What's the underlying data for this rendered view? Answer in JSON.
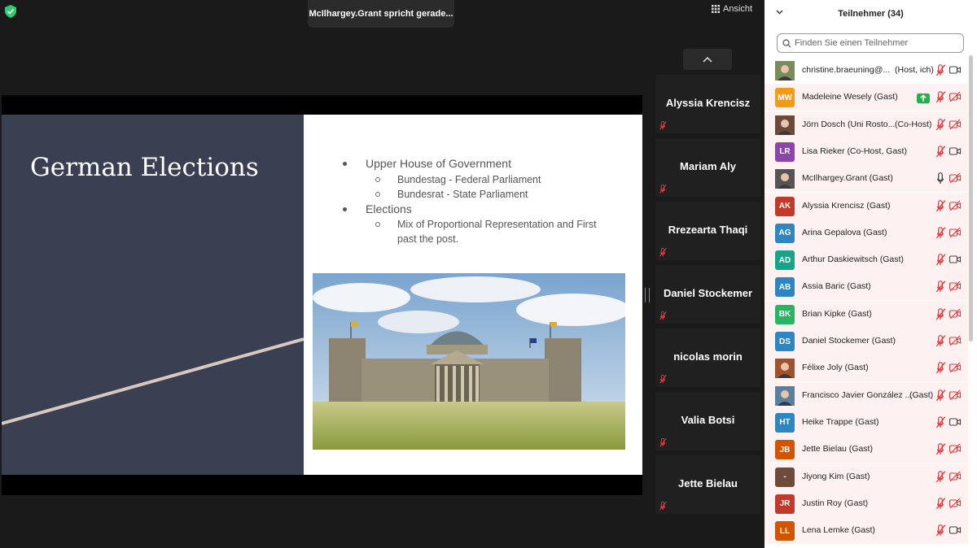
{
  "speaker": "McIlhargey.Grant spricht gerade...",
  "view_label": "Ansicht",
  "slide": {
    "title": "German Elections",
    "bullets": [
      {
        "level": 1,
        "text": "Upper House of Government"
      },
      {
        "level": 2,
        "text": "Bundestag - Federal Parliament"
      },
      {
        "level": 2,
        "text": "Bundesrat - State Parliament"
      },
      {
        "level": 1,
        "text": "Elections"
      },
      {
        "level": 2,
        "text": "Mix of Proportional Representation and First"
      },
      {
        "level": 0,
        "text": "past the post."
      }
    ]
  },
  "tiles": [
    "Alyssia Krencisz",
    "Mariam Aly",
    "Rrezearta Thaqi",
    "Daniel Stockemer",
    "nicolas morin",
    "Valia Botsi",
    "Jette Bielau"
  ],
  "panel": {
    "title": "Teilnehmer (34)",
    "search_placeholder": "Finden Sie einen Teilnehmer",
    "participants": [
      {
        "initials": "",
        "photo": true,
        "name": "christine.braeuning@...",
        "role": "(Host, ich)",
        "mic": "muted",
        "cam": "on",
        "color": "#7a8c5a"
      },
      {
        "initials": "MW",
        "name": "Madeleine Wesely (Gast)",
        "role": "",
        "mic": "muted",
        "cam": "off",
        "color": "#f39c12",
        "share": true
      },
      {
        "initials": "",
        "photo": true,
        "name": "Jörn Dosch (Uni Rosto...",
        "role": "(Co-Host)",
        "mic": "muted",
        "cam": "off",
        "color": "#6b4a3a"
      },
      {
        "initials": "LR",
        "name": "Lisa Rieker (Co-Host, Gast)",
        "role": "",
        "mic": "muted",
        "cam": "on",
        "color": "#8e44ad"
      },
      {
        "initials": "",
        "photo": true,
        "name": "McIlhargey.Grant (Gast)",
        "role": "",
        "mic": "on",
        "cam": "off",
        "color": "#555555"
      },
      {
        "initials": "AK",
        "name": "Alyssia Krencisz (Gast)",
        "role": "",
        "mic": "muted",
        "cam": "off",
        "color": "#c0392b"
      },
      {
        "initials": "AG",
        "name": "Arina Gepalova (Gast)",
        "role": "",
        "mic": "muted",
        "cam": "off",
        "color": "#2e86c1"
      },
      {
        "initials": "AD",
        "name": "Arthur Daskiewitsch (Gast)",
        "role": "",
        "mic": "muted",
        "cam": "on",
        "color": "#17a589"
      },
      {
        "initials": "AB",
        "name": "Assia Baric (Gast)",
        "role": "",
        "mic": "muted",
        "cam": "off",
        "color": "#2e86c1"
      },
      {
        "initials": "BK",
        "name": "Brian Kipke (Gast)",
        "role": "",
        "mic": "muted",
        "cam": "off",
        "color": "#28b463"
      },
      {
        "initials": "DS",
        "name": "Daniel Stockemer (Gast)",
        "role": "",
        "mic": "muted",
        "cam": "off",
        "color": "#2e86c1"
      },
      {
        "initials": "",
        "photo": true,
        "name": "Félixe Joly (Gast)",
        "role": "",
        "mic": "muted",
        "cam": "off",
        "color": "#a0522d"
      },
      {
        "initials": "",
        "photo": true,
        "name": "Francisco Javier González ...",
        "role": "(Gast)",
        "mic": "muted",
        "cam": "off",
        "color": "#5a7fa0"
      },
      {
        "initials": "HT",
        "name": "Heike Trappe (Gast)",
        "role": "",
        "mic": "muted",
        "cam": "on",
        "color": "#2e86c1"
      },
      {
        "initials": "JB",
        "name": "Jette Bielau (Gast)",
        "role": "",
        "mic": "muted",
        "cam": "off",
        "color": "#d35400"
      },
      {
        "initials": "-",
        "name": "Jiyong Kim (Gast)",
        "role": "",
        "mic": "muted",
        "cam": "off",
        "color": "#6e4b3a"
      },
      {
        "initials": "JR",
        "name": "Justin Roy (Gast)",
        "role": "",
        "mic": "muted",
        "cam": "off",
        "color": "#c0392b"
      },
      {
        "initials": "LL",
        "name": "Lena Lemke (Gast)",
        "role": "",
        "mic": "muted",
        "cam": "on",
        "color": "#d35400"
      }
    ]
  }
}
